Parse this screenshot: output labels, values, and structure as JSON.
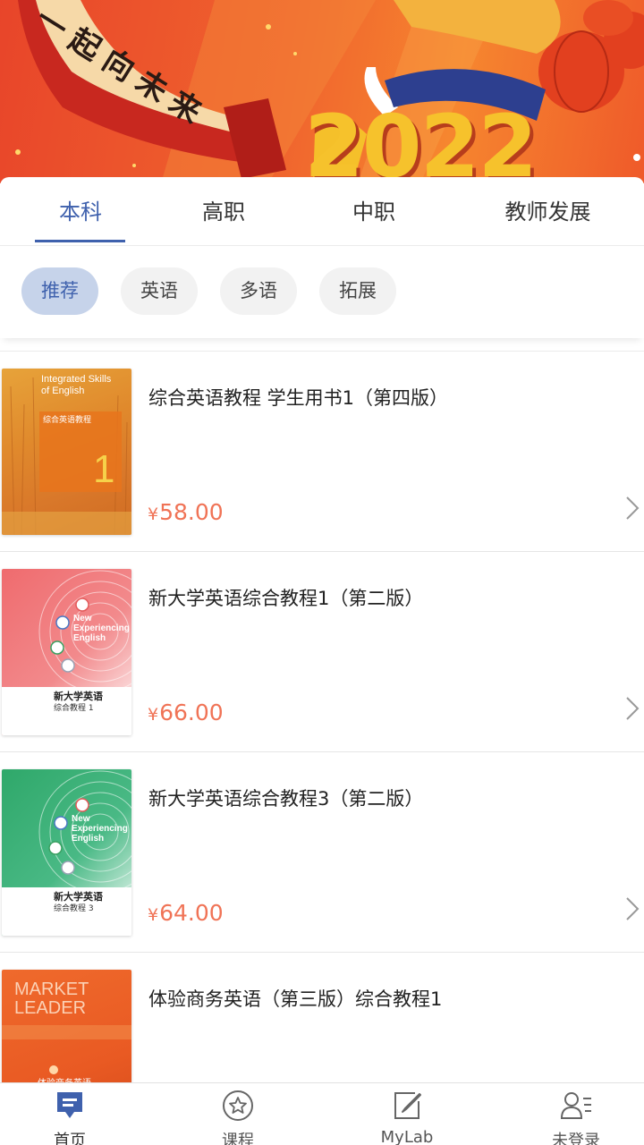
{
  "banner": {
    "year": "2022",
    "scroll_text": "一起向未来",
    "colors": {
      "bg": "#ef5a2a",
      "scroll": "#c8281f",
      "gold": "#f5c02a"
    }
  },
  "tabs": [
    {
      "label": "本科",
      "active": true
    },
    {
      "label": "高职",
      "active": false
    },
    {
      "label": "中职",
      "active": false
    },
    {
      "label": "教师发展",
      "active": false
    }
  ],
  "chips": [
    {
      "label": "推荐",
      "active": true
    },
    {
      "label": "英语",
      "active": false
    },
    {
      "label": "多语",
      "active": false
    },
    {
      "label": "拓展",
      "active": false
    }
  ],
  "books": [
    {
      "title": "综合英语教程 学生用书1（第四版）",
      "currency": "¥",
      "price": "58.00",
      "cover": {
        "theme": "orange-forest",
        "title_line1": "Integrated Skills",
        "title_line2": "of English",
        "cn": "综合英语教程",
        "number": "1"
      }
    },
    {
      "title": "新大学英语综合教程1（第二版）",
      "currency": "¥",
      "price": "66.00",
      "cover": {
        "theme": "red-rings",
        "en1": "New",
        "en2": "Experiencing",
        "en3": "English",
        "cn": "新大学英语",
        "sub": "综合教程 1"
      }
    },
    {
      "title": "新大学英语综合教程3（第二版）",
      "currency": "¥",
      "price": "64.00",
      "cover": {
        "theme": "green-rings",
        "en1": "New",
        "en2": "Experiencing",
        "en3": "English",
        "cn": "新大学英语",
        "sub": "综合教程 3"
      }
    },
    {
      "title": "体验商务英语（第三版）综合教程1",
      "currency": "",
      "price": "",
      "cover": {
        "theme": "orange-business",
        "en1": "MARKET",
        "en2": "LEADER",
        "cn": "体验商务英语"
      }
    }
  ],
  "bottom_nav": [
    {
      "label": "首页",
      "icon": "home-book-icon",
      "active": true
    },
    {
      "label": "课程",
      "icon": "star-circle-icon",
      "active": false
    },
    {
      "label": "MyLab",
      "icon": "edit-square-icon",
      "active": false
    },
    {
      "label": "未登录",
      "icon": "user-list-icon",
      "active": false
    }
  ],
  "colors": {
    "accent": "#3f61ad",
    "price": "#f07356",
    "chip_active_bg": "#c6d3ea"
  }
}
